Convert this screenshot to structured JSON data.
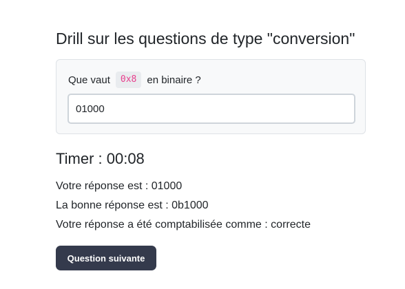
{
  "page": {
    "title": "Drill sur les questions de type \"conversion\""
  },
  "question": {
    "prefix": "Que vaut",
    "code": "0x8",
    "suffix": "en binaire ?",
    "input_value": "01000"
  },
  "timer": {
    "text": "Timer : 00:08"
  },
  "result": {
    "your_answer": "Votre réponse est : 01000",
    "correct_answer": "La bonne réponse est : 0b1000",
    "verdict": "Votre réponse a été comptabilisée comme : correcte"
  },
  "actions": {
    "next_label": "Question suivante"
  }
}
